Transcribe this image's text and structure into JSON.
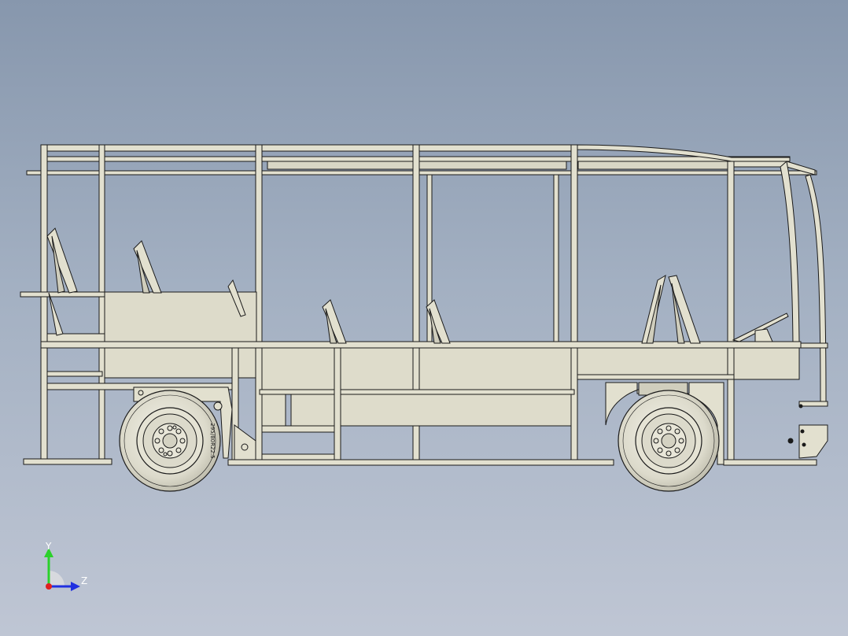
{
  "viewport": {
    "background_top": "#8797ad",
    "background_bottom": "#bfc6d4",
    "model_color": "#e2e0cf",
    "edge_color": "#1a1a1a"
  },
  "triad": {
    "y_label": "Y",
    "z_label": "Z",
    "y_color": "#2bd12b",
    "z_color": "#2030e0",
    "x_color": "#e02020"
  },
  "tire_text": "295/80R22.5"
}
